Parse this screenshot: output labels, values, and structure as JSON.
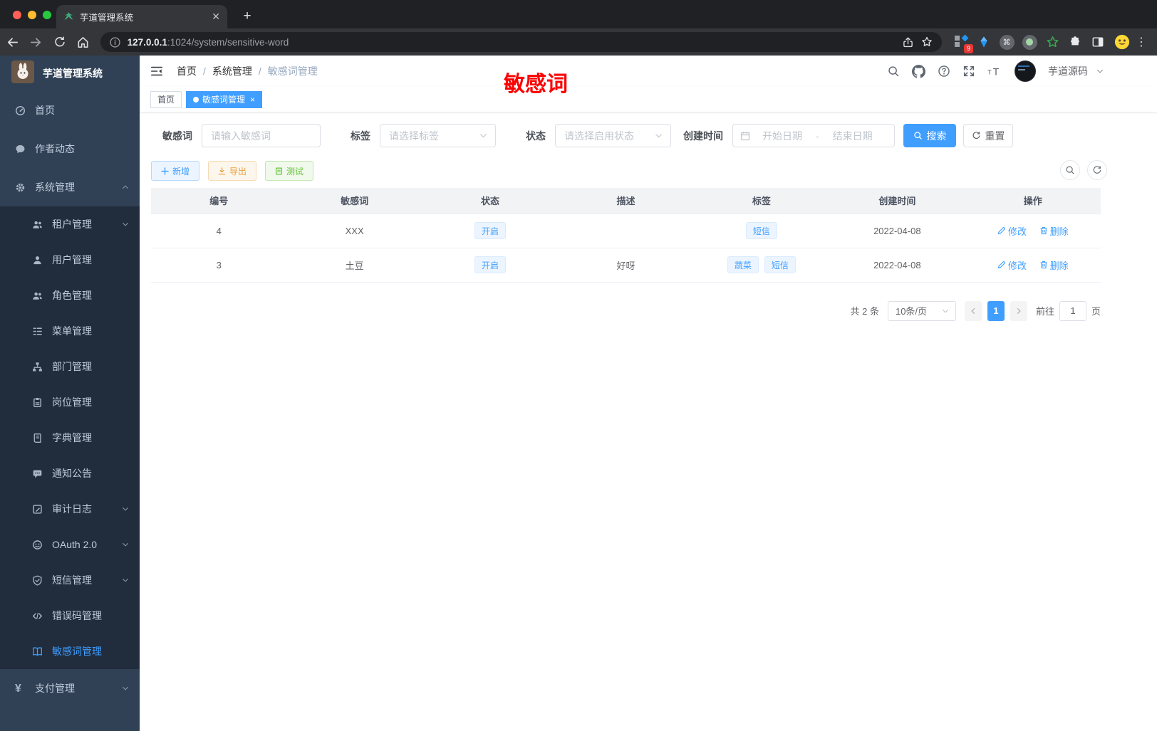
{
  "colors": {
    "primary": "#409eff",
    "annotation_red": "#fb0200",
    "warning": "#e6a23c",
    "success": "#67c23a"
  },
  "browser": {
    "tab": {
      "title": "芋道管理系统",
      "favicon": "leaf-icon"
    },
    "url": {
      "host": "127.0.0.1",
      "rest": ":1024/system/sensitive-word"
    },
    "extension_badge": "9",
    "toolbar_icons": [
      "back",
      "forward",
      "reload",
      "home",
      "info",
      "share",
      "bookmark-star",
      "extensions-grid",
      "kite",
      "command-circle",
      "record-circle",
      "green-star",
      "puzzle",
      "side-panel",
      "emoji-avatar",
      "kebab-menu"
    ]
  },
  "sidebar": {
    "title": "芋道管理系统",
    "items": [
      {
        "label": "首页",
        "icon": "dashboard",
        "level": 1
      },
      {
        "label": "作者动态",
        "icon": "message",
        "level": 1
      },
      {
        "label": "系统管理",
        "icon": "gear",
        "level": 1,
        "arrow": "up"
      },
      {
        "label": "租户管理",
        "icon": "users",
        "level": 2,
        "arrow": "down"
      },
      {
        "label": "用户管理",
        "icon": "user",
        "level": 2
      },
      {
        "label": "角色管理",
        "icon": "users",
        "level": 2
      },
      {
        "label": "菜单管理",
        "icon": "tree-list",
        "level": 2
      },
      {
        "label": "部门管理",
        "icon": "org-chart",
        "level": 2
      },
      {
        "label": "岗位管理",
        "icon": "id-badge",
        "level": 2
      },
      {
        "label": "字典管理",
        "icon": "dictionary",
        "level": 2
      },
      {
        "label": "通知公告",
        "icon": "notice",
        "level": 2
      },
      {
        "label": "审计日志",
        "icon": "audit-log",
        "level": 2,
        "arrow": "down"
      },
      {
        "label": "OAuth 2.0",
        "icon": "oauth",
        "level": 2,
        "arrow": "down"
      },
      {
        "label": "短信管理",
        "icon": "shield-check",
        "level": 2,
        "arrow": "down"
      },
      {
        "label": "错误码管理",
        "icon": "code",
        "level": 2
      },
      {
        "label": "敏感词管理",
        "icon": "open-book",
        "level": 2,
        "active": true
      },
      {
        "label": "支付管理",
        "icon": "yen",
        "level": 1,
        "arrow": "down"
      }
    ]
  },
  "header": {
    "breadcrumb": [
      "首页",
      "系统管理",
      "敏感词管理"
    ],
    "breadcrumb_separator": "/",
    "annotation": "敏感词",
    "right_icons": [
      "search",
      "github",
      "help",
      "fullscreen",
      "font-size"
    ],
    "user": {
      "name": "芋道源码"
    }
  },
  "tags_view": [
    {
      "label": "首页",
      "active": false
    },
    {
      "label": "敏感词管理",
      "active": true,
      "closable": true
    }
  ],
  "filters": {
    "keyword": {
      "label": "敏感词",
      "placeholder": "请输入敏感词"
    },
    "tag": {
      "label": "标签",
      "placeholder": "请选择标签"
    },
    "status": {
      "label": "状态",
      "placeholder": "请选择启用状态"
    },
    "create_time": {
      "label": "创建时间",
      "start_placeholder": "开始日期",
      "separator": "-",
      "end_placeholder": "结束日期"
    },
    "search_btn": "搜索",
    "reset_btn": "重置"
  },
  "toolbar": {
    "add": "新增",
    "export": "导出",
    "test": "测试"
  },
  "table": {
    "columns": [
      "编号",
      "敏感词",
      "状态",
      "描述",
      "标签",
      "创建时间",
      "操作"
    ],
    "rows": [
      {
        "id": "4",
        "word": "XXX",
        "status": "开启",
        "desc": "",
        "tags": [
          "短信"
        ],
        "created": "2022-04-08",
        "edit": "修改",
        "delete": "删除"
      },
      {
        "id": "3",
        "word": "土豆",
        "status": "开启",
        "desc": "好呀",
        "tags": [
          "蔬菜",
          "短信"
        ],
        "created": "2022-04-08",
        "edit": "修改",
        "delete": "删除"
      }
    ]
  },
  "pagination": {
    "total": "共 2 条",
    "page_size": "10条/页",
    "current": "1",
    "goto_label": "前往",
    "goto_value": "1",
    "page_suffix": "页"
  }
}
